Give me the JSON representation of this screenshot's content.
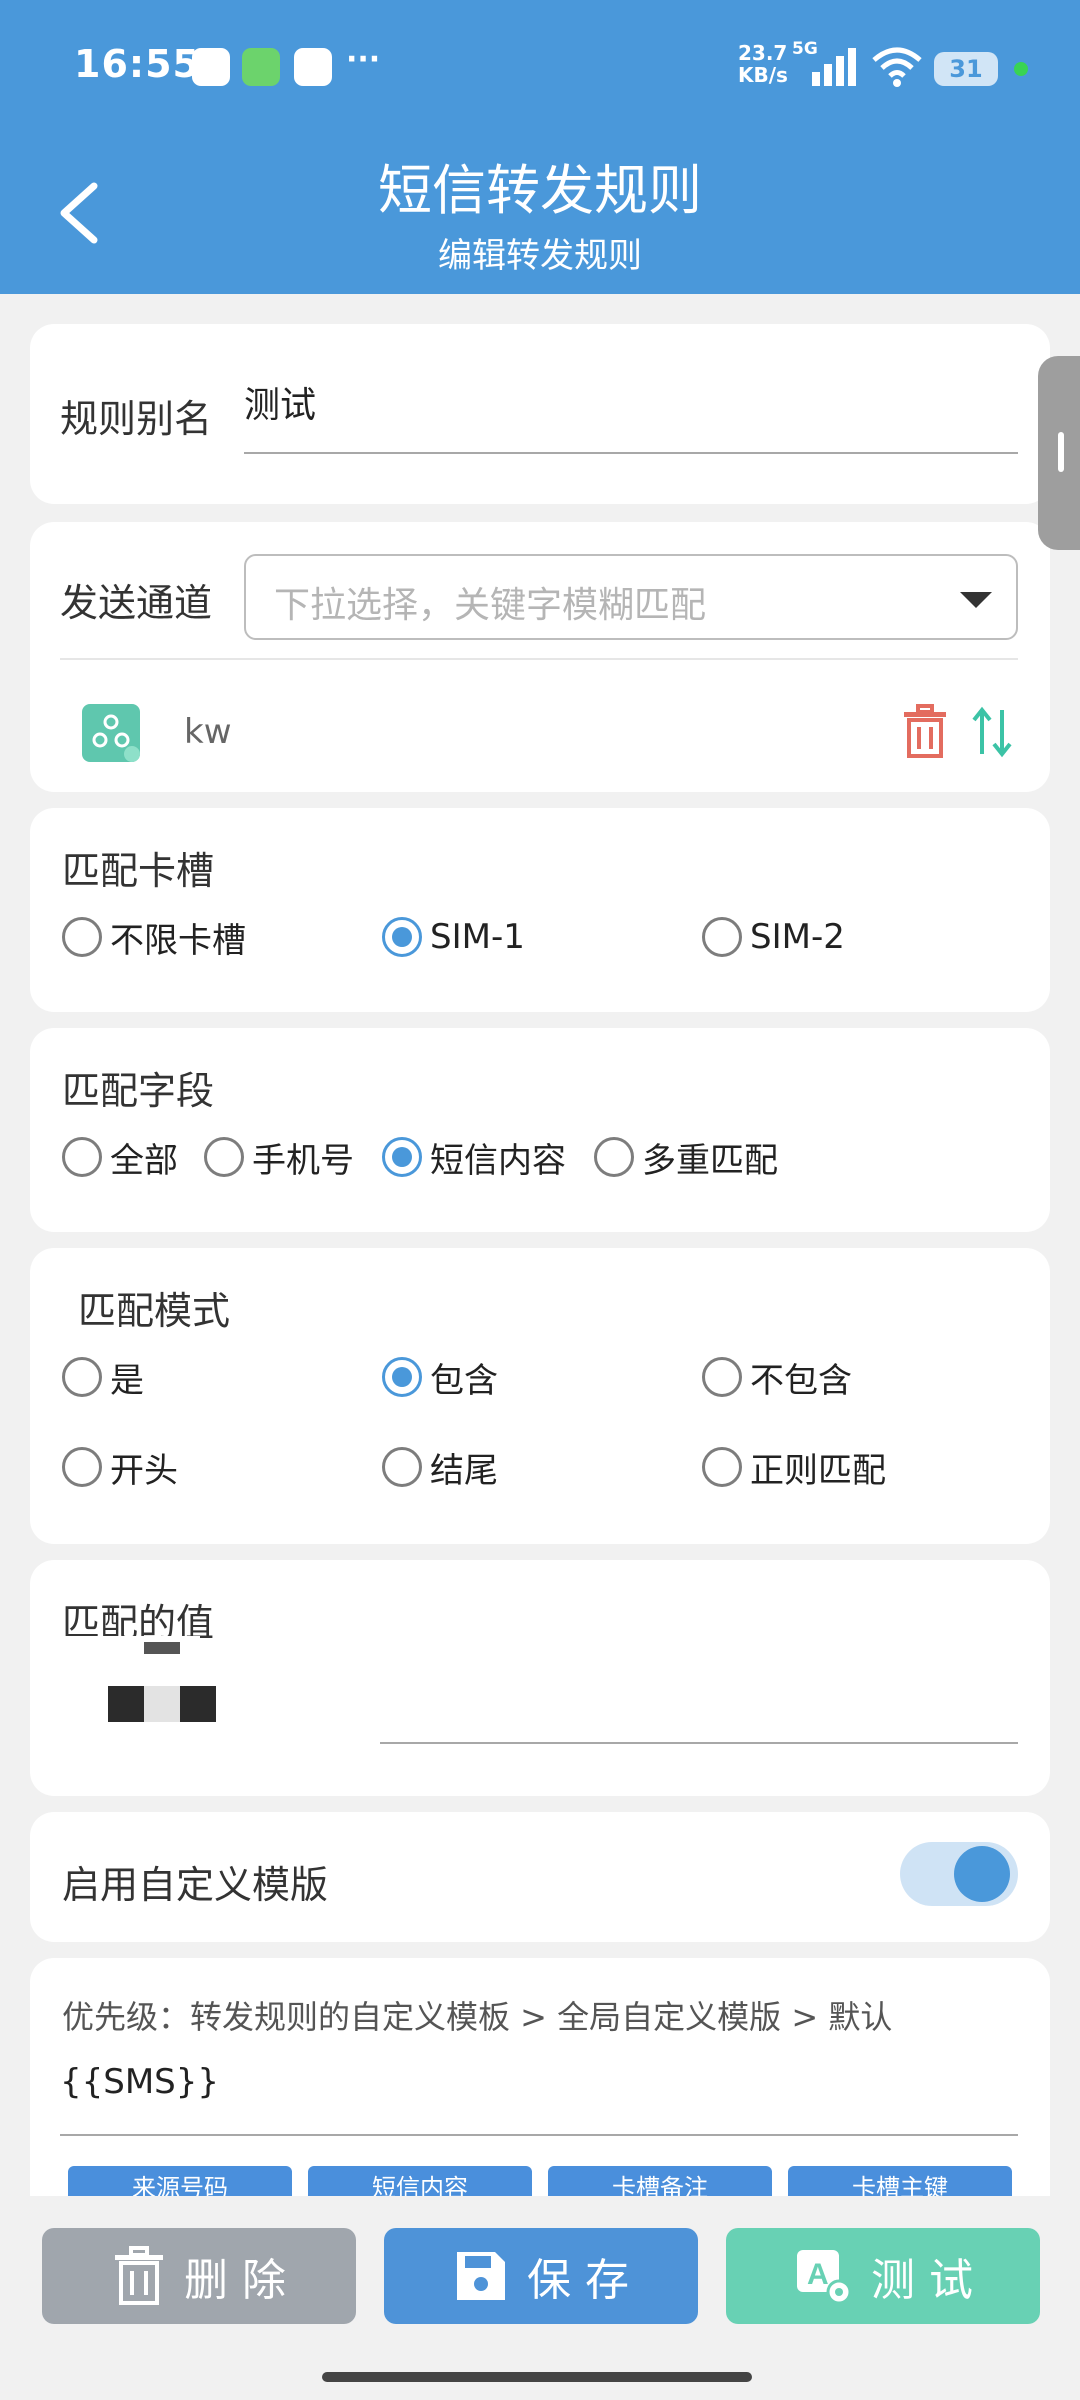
{
  "status_bar": {
    "time": "16:55",
    "more": "···",
    "net_speed_value": "23.7",
    "net_speed_unit": "KB/s",
    "net_type": "5G",
    "battery": "31"
  },
  "header": {
    "title": "短信转发规则",
    "subtitle": "编辑转发规则"
  },
  "alias": {
    "label": "规则别名",
    "value": "测试"
  },
  "channel": {
    "label": "发送通道",
    "placeholder": "下拉选择，关键字模糊匹配",
    "item_name": "kw"
  },
  "sim_slot": {
    "label": "匹配卡槽",
    "options": [
      "不限卡槽",
      "SIM-1",
      "SIM-2"
    ],
    "selected": "SIM-1"
  },
  "match_field": {
    "label": "匹配字段",
    "options": [
      "全部",
      "手机号",
      "短信内容",
      "多重匹配"
    ],
    "selected": "短信内容"
  },
  "match_mode": {
    "label": "匹配模式",
    "options": [
      "是",
      "包含",
      "不包含",
      "开头",
      "结尾",
      "正则匹配"
    ],
    "selected": "包含"
  },
  "match_value": {
    "label": "匹配的值"
  },
  "custom_template": {
    "label": "启用自定义模版",
    "enabled": true
  },
  "template": {
    "hint": "优先级：转发规则的自定义模板 > 全局自定义模版 > 默认",
    "value": "{{SMS}}",
    "chips": [
      "来源号码",
      "短信内容",
      "卡槽备注",
      "卡槽主键"
    ]
  },
  "actions": {
    "delete": "删 除",
    "save": "保 存",
    "test": "测 试"
  },
  "colors": {
    "primary": "#4a98da",
    "delete_button": "#a0a6ad",
    "save_button": "#4e93d8",
    "test_button": "#68d1b4",
    "trash_icon": "#e36c5f",
    "swap_icon": "#3cc3a6"
  }
}
